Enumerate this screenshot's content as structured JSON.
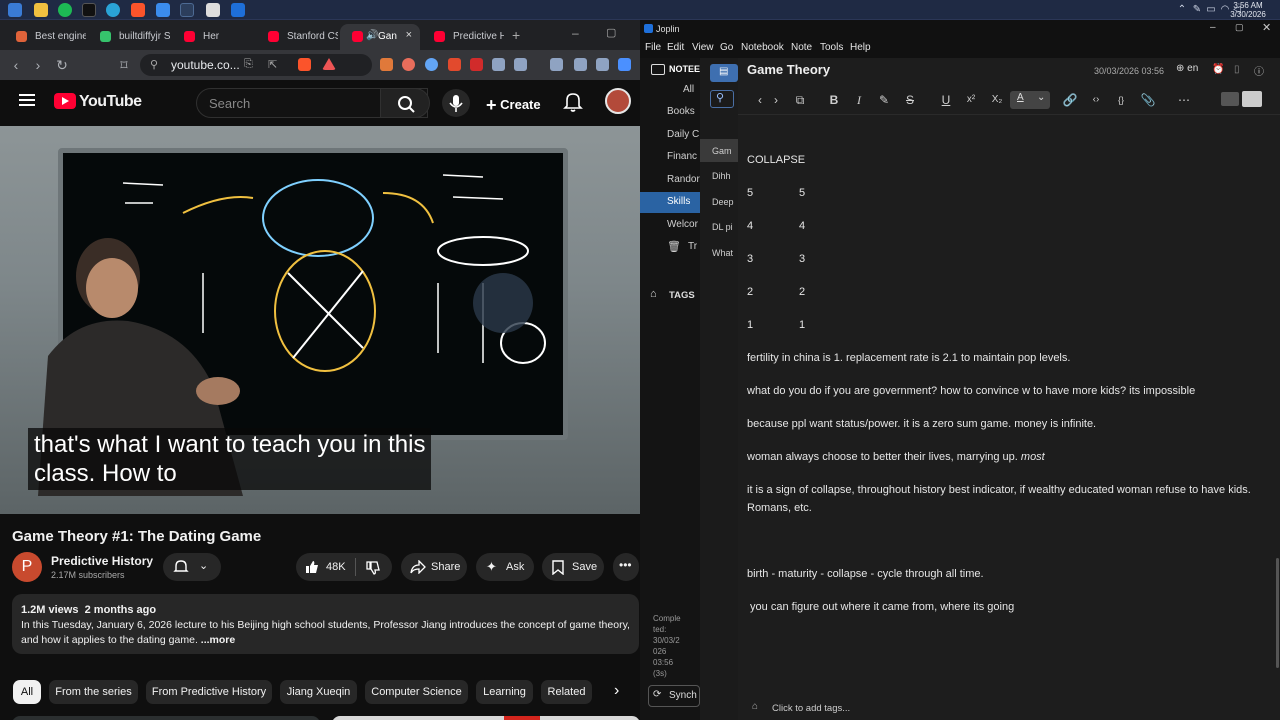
{
  "taskbar": {
    "clock_time": "3:56 AM",
    "clock_date": "3/30/2026"
  },
  "browser": {
    "tabs": [
      {
        "label": "Best engine",
        "fav": "#e0633a"
      },
      {
        "label": "builtdiffyjr S",
        "fav": "#36c36c"
      },
      {
        "label": "Her",
        "fav": "#ff0033"
      },
      {
        "label": "Stanford CS",
        "fav": "#ff0033"
      },
      {
        "label": "Gan",
        "fav": "#ff0033",
        "active": true
      },
      {
        "label": "Predictive H",
        "fav": "#ff0033"
      }
    ],
    "new_tab": "+",
    "url": "youtube.co...",
    "tab_close": "×"
  },
  "youtube": {
    "logo": "YouTube",
    "search_placeholder": "Search",
    "create_label": "Create",
    "caption_line1": "that's what I want to teach you in this",
    "caption_line2": "class. How to",
    "video_title": "Game Theory #1: The Dating Game",
    "avatar_letter": "P",
    "channel": "Predictive History",
    "subscribers": "2.17M subscribers",
    "likes": "48K",
    "share": "Share",
    "ask": "Ask",
    "save": "Save",
    "views": "1.2M views",
    "posted": "2 months ago",
    "description": "In this Tuesday, January 6, 2026 lecture to his Beijing high school students, Professor Jiang introduces the concept of game theory,",
    "description2": "and how it applies to the dating game.",
    "more": "...more",
    "chips": [
      "All",
      "From the series",
      "From Predictive History",
      "Jiang Xueqin",
      "Computer Science",
      "Learning",
      "Related"
    ]
  },
  "joplin": {
    "window_title": "Joplin",
    "menu": [
      "File",
      "Edit",
      "View",
      "Go",
      "Notebook",
      "Note",
      "Tools",
      "Help"
    ],
    "sidebar_header": "NOTEE",
    "notebooks": [
      "All",
      "Books",
      "Daily C",
      "Financ",
      "Randor",
      "Skills",
      "Welcor",
      "Tr"
    ],
    "selected_notebook": "Skills",
    "tags_label": "TAGS",
    "notes": [
      "Gam",
      "Dihh",
      "Deep",
      "DL pi",
      "What"
    ],
    "completed": [
      "Comple",
      "ted:",
      "30/03/2",
      "026",
      "03:56",
      "(3s)"
    ],
    "sync": "Synch",
    "note_title": "Game Theory",
    "note_date": "30/03/2026 03:56",
    "lang": "en",
    "lines": [
      "COLLAPSE",
      "5               5",
      "4               4",
      "3               3",
      "2               2",
      "1               1",
      "fertility in china is 1. replacement rate is 2.1 to maintain pop levels.",
      "what do you do if you are government? how to convince w to have more kids? its impossible",
      "because ppl want status/power. it is a zero sum game. money is infinite.",
      "woman always choose to better their lives, marrying up.",
      "it is a sign of collapse, throughout history best indicator, if wealthy educated woman refuse to have kids.",
      "Romans, etc.",
      "birth - maturity - collapse - cycle through all time.",
      " you can figure out where it came from, where its going"
    ],
    "italic_word": "most",
    "add_tags": "Click to add tags..."
  }
}
